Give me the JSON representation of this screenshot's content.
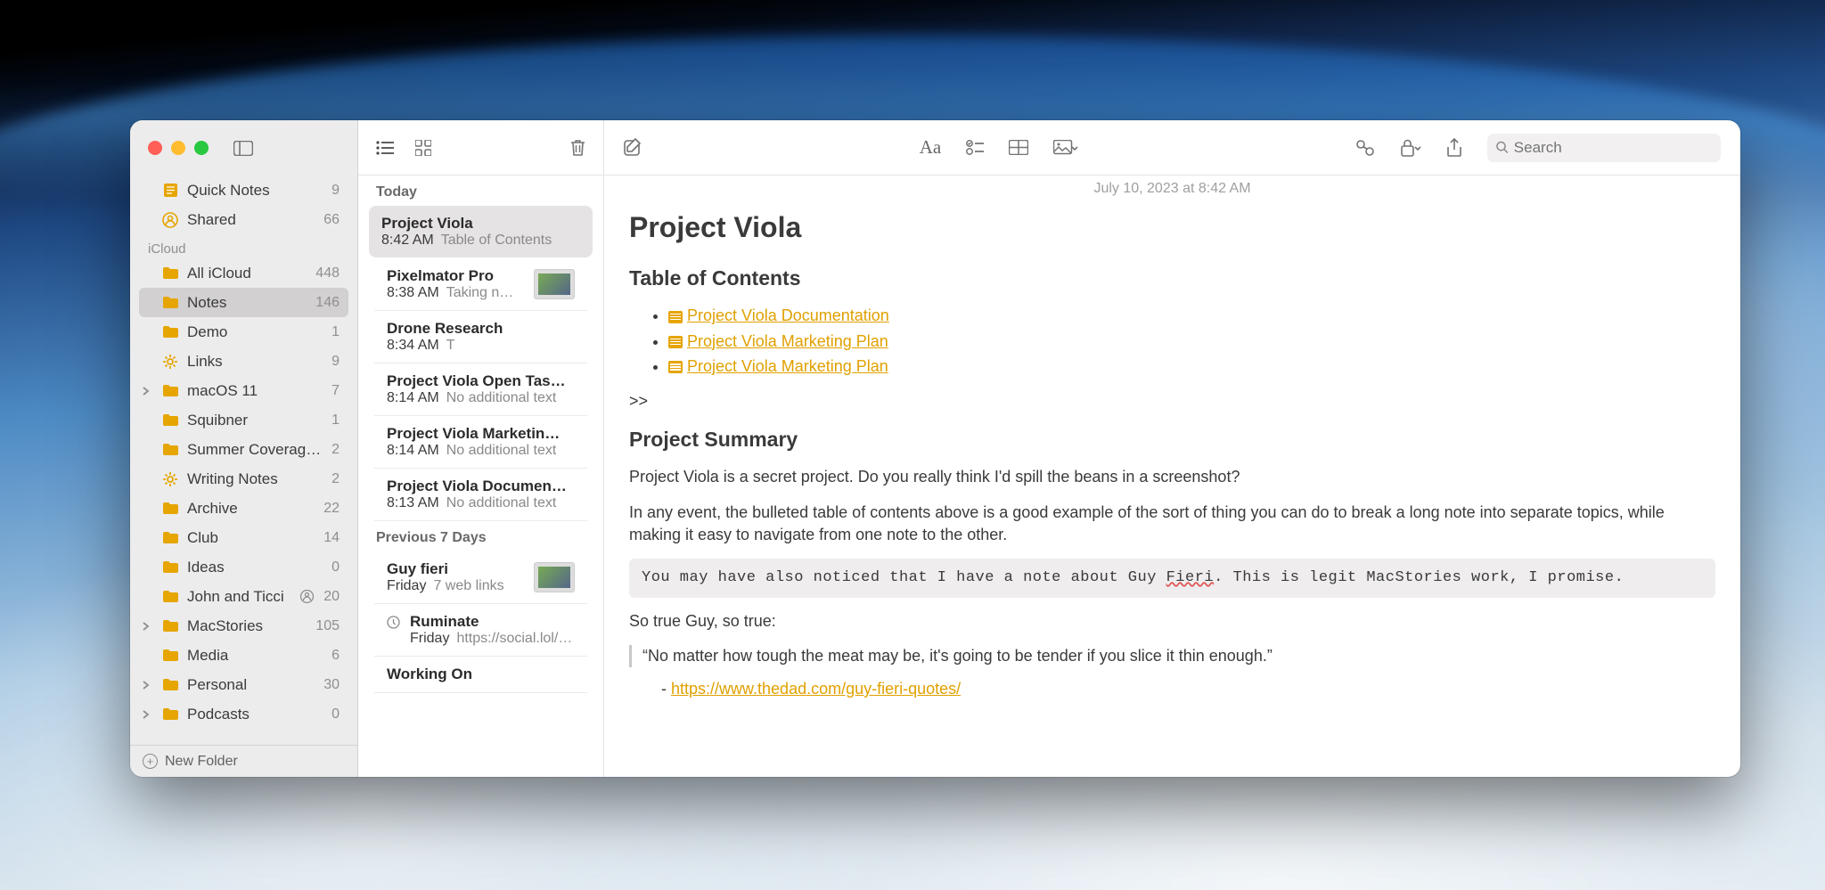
{
  "sidebar": {
    "top": [
      {
        "icon": "quick",
        "label": "Quick Notes",
        "count": "9"
      },
      {
        "icon": "shared",
        "label": "Shared",
        "count": "66"
      }
    ],
    "section_label": "iCloud",
    "folders": [
      {
        "chev": "",
        "icon": "folder",
        "label": "All iCloud",
        "count": "448"
      },
      {
        "chev": "",
        "icon": "folder",
        "label": "Notes",
        "count": "146",
        "selected": true
      },
      {
        "chev": "",
        "icon": "folder",
        "label": "Demo",
        "count": "1"
      },
      {
        "chev": "",
        "icon": "gear",
        "label": "Links",
        "count": "9"
      },
      {
        "chev": ">",
        "icon": "folder",
        "label": "macOS 11",
        "count": "7"
      },
      {
        "chev": "",
        "icon": "folder",
        "label": "Squibner",
        "count": "1"
      },
      {
        "chev": "",
        "icon": "folder",
        "label": "Summer Coverage…",
        "count": "2"
      },
      {
        "chev": "",
        "icon": "gear",
        "label": "Writing Notes",
        "count": "2"
      },
      {
        "chev": "",
        "icon": "folder",
        "label": "Archive",
        "count": "22"
      },
      {
        "chev": "",
        "icon": "folder",
        "label": "Club",
        "count": "14"
      },
      {
        "chev": "",
        "icon": "folder",
        "label": "Ideas",
        "count": "0"
      },
      {
        "chev": "",
        "icon": "folder",
        "label": "John and Ticci",
        "count": "20",
        "shared": true
      },
      {
        "chev": ">",
        "icon": "folder",
        "label": "MacStories",
        "count": "105"
      },
      {
        "chev": "",
        "icon": "folder",
        "label": "Media",
        "count": "6"
      },
      {
        "chev": ">",
        "icon": "folder",
        "label": "Personal",
        "count": "30"
      },
      {
        "chev": ">",
        "icon": "folder",
        "label": "Podcasts",
        "count": "0"
      }
    ],
    "new_folder": "New Folder"
  },
  "notes": {
    "sections": [
      {
        "label": "Today",
        "items": [
          {
            "title": "Project Viola",
            "time": "8:42 AM",
            "snippet": "Table of Contents",
            "selected": true
          },
          {
            "title": "Pixelmator Pro",
            "time": "8:38 AM",
            "snippet": "Taking n…",
            "thumb": true
          },
          {
            "title": "Drone Research",
            "time": "8:34 AM",
            "snippet": "T"
          },
          {
            "title": "Project Viola Open Tas…",
            "time": "8:14 AM",
            "snippet": "No additional text"
          },
          {
            "title": "Project Viola Marketin…",
            "time": "8:14 AM",
            "snippet": "No additional text"
          },
          {
            "title": "Project Viola Documen…",
            "time": "8:13 AM",
            "snippet": "No additional text"
          }
        ]
      },
      {
        "label": "Previous 7 Days",
        "items": [
          {
            "title": "Guy fieri",
            "time": "Friday",
            "snippet": "7 web links",
            "thumb": true
          },
          {
            "title": "Ruminate",
            "time": "Friday",
            "snippet": "https://social.lol/@…",
            "shared": true
          },
          {
            "title": "Working On",
            "time": "",
            "snippet": ""
          }
        ]
      }
    ]
  },
  "editor": {
    "timestamp": "July 10, 2023 at 8:42 AM",
    "title": "Project Viola",
    "toc_heading": "Table of Contents",
    "toc": [
      "Project Viola Documentation",
      "Project Viola Marketing Plan",
      "Project Viola Marketing Plan"
    ],
    "chevrons": ">>",
    "summary_heading": "Project Summary",
    "p1": "Project Viola is a secret project. Do you really think I'd spill the beans in a screenshot?",
    "p2": "In any event, the bulleted table of contents above is a good example of the sort of thing you can do to break a long note into separate topics, while making it easy to navigate from one note to the other.",
    "code_pre": "You may have also noticed that I have a note about Guy ",
    "code_squiggle": "Fieri",
    "code_post": ". This is legit MacStories work, I promise.",
    "p3": "So true Guy, so true:",
    "quote": "“No matter how tough the meat may be, it's going to be tender if you slice it thin enough.”",
    "dash": "- ",
    "link": "https://www.thedad.com/guy-fieri-quotes/"
  },
  "search_placeholder": "Search"
}
